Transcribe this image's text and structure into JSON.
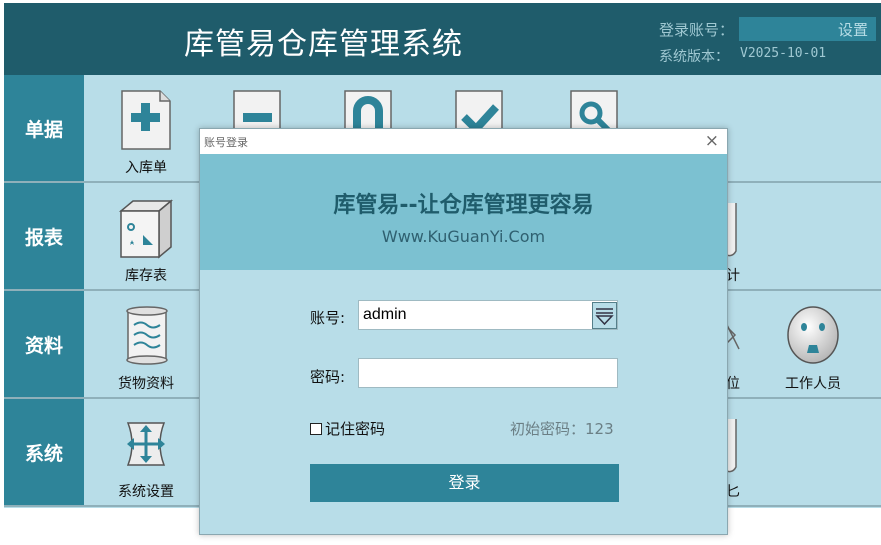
{
  "header": {
    "title": "库管易仓库管理系统",
    "account_label": "登录账号：",
    "settings_label": "设置",
    "version_label": "系统版本：",
    "version_value": "V2025-10-01"
  },
  "rows": [
    {
      "label": "单据",
      "tiles": [
        {
          "icon": "plus-icon",
          "label": "入库单"
        }
      ]
    },
    {
      "label": "报表",
      "tiles": [
        {
          "icon": "box-icon",
          "label": "库存表"
        },
        {
          "icon": "cylinder-icon",
          "label": "计"
        }
      ]
    },
    {
      "label": "资料",
      "tiles": [
        {
          "icon": "scroll-icon",
          "label": "货物资料"
        },
        {
          "icon": "bow-tie-icon",
          "label": "位"
        },
        {
          "icon": "face-icon",
          "label": "工作人员"
        }
      ]
    },
    {
      "label": "系统",
      "tiles": [
        {
          "icon": "move-arrows-icon",
          "label": "系统设置"
        },
        {
          "icon": "cylinder-icon",
          "label": "匕"
        }
      ]
    }
  ],
  "dialog": {
    "title": "账号登录",
    "close_glyph": "×",
    "slogan": "库管易--让仓库管理更容易",
    "website": "Www.KuGuanYi.Com",
    "account_label": "账号:",
    "account_value": "admin",
    "password_label": "密码:",
    "password_value": "",
    "remember_label": "记住密码",
    "initial_password_hint": "初始密码：123",
    "login_button": "登录"
  },
  "colors": {
    "header_bg": "#1f5c6b",
    "accent": "#2e8499",
    "panel_bg": "#b8dde8",
    "banner_bg": "#7cc1d1"
  }
}
